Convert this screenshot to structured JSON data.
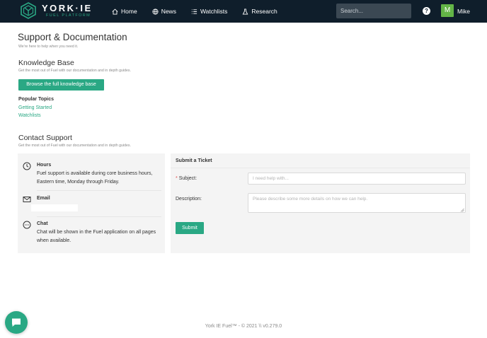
{
  "brand": {
    "name": "YORK·IE",
    "tagline": "FUEL PLATFORM"
  },
  "nav": [
    {
      "label": "Home",
      "icon": "home-icon"
    },
    {
      "label": "News",
      "icon": "globe-icon"
    },
    {
      "label": "Watchlists",
      "icon": "list-icon"
    },
    {
      "label": "Research",
      "icon": "flask-icon"
    }
  ],
  "search": {
    "placeholder": "Search..."
  },
  "help": {
    "label": "?"
  },
  "user": {
    "initial": "M",
    "name": "Mike"
  },
  "page": {
    "title": "Support & Documentation",
    "subtitle": "We're here to help when you need it."
  },
  "knowledge_base": {
    "title": "Knowledge Base",
    "subtitle": "Get the most out of Fuel with our documentation and in depth guides.",
    "button": "Browse the full knowledge base",
    "popular_title": "Popular Topics",
    "topics": [
      "Getting Started",
      "Watchlists"
    ]
  },
  "contact": {
    "title": "Contact Support",
    "subtitle": "Get the most out of Fuel with our documentation and in depth guides.",
    "hours_title": "Hours",
    "hours_text": "Fuel support is available during core business hours, Eastern time, Monday through Friday.",
    "email_title": "Email",
    "chat_title": "Chat",
    "chat_text": "Chat will be shown in the Fuel application on all pages when available."
  },
  "ticket": {
    "title": "Submit a Ticket",
    "required_mark": "*",
    "subject_label": "Subject:",
    "subject_placeholder": "I need help with...",
    "description_label": "Description:",
    "description_placeholder": "Please describe some more details on how we can help.",
    "submit": "Submit"
  },
  "footer": "York IE Fuel™ - © 2021 \\\\ v0.279.0",
  "colors": {
    "nav_bg": "#0f1e2b",
    "accent": "#2aa884",
    "avatar": "#63b547"
  }
}
